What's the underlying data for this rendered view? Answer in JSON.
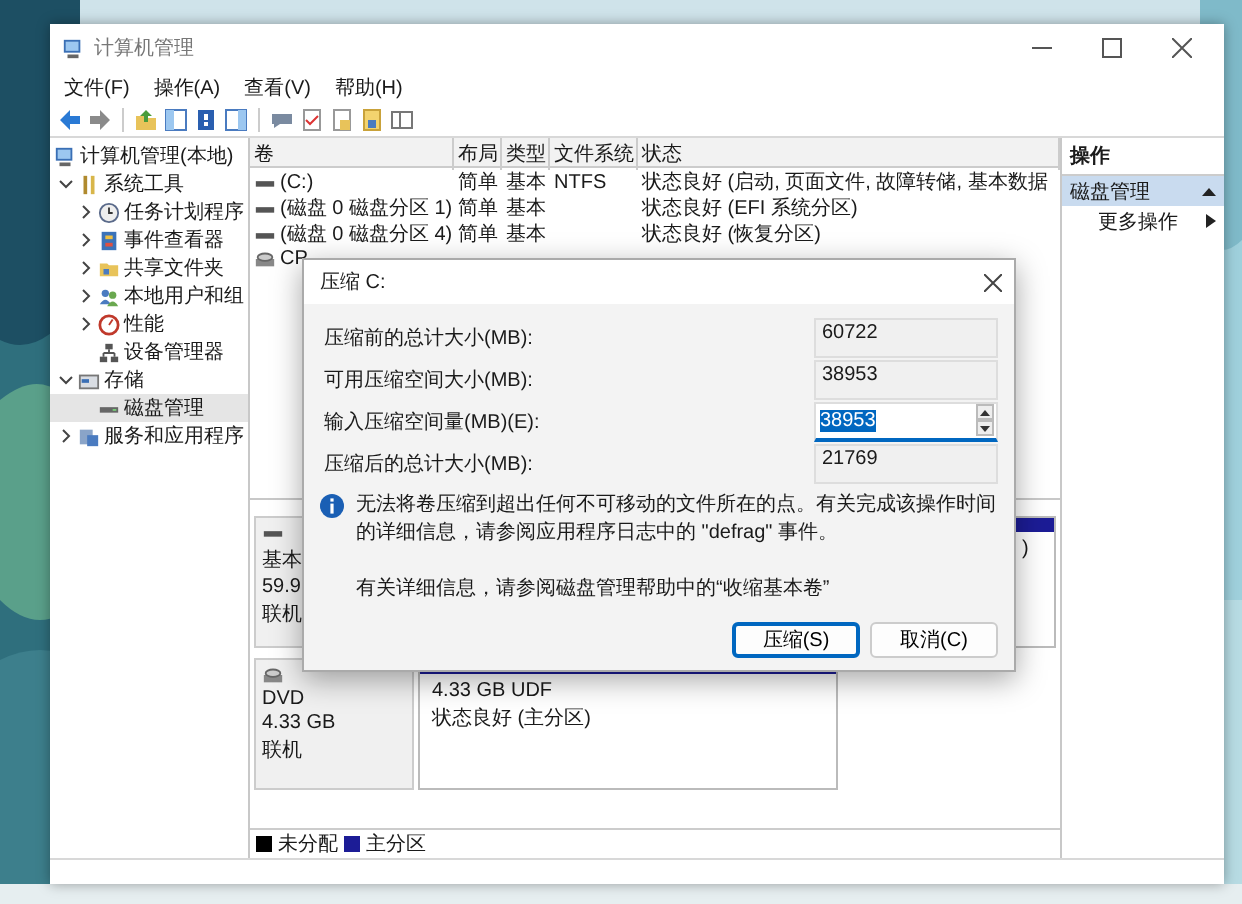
{
  "window": {
    "title": "计算机管理"
  },
  "menu": [
    "文件(F)",
    "操作(A)",
    "查看(V)",
    "帮助(H)"
  ],
  "tree": {
    "root": "计算机管理(本地)",
    "items": [
      {
        "label": "系统工具",
        "expanded": true,
        "selected": false,
        "children": [
          {
            "label": "任务计划程序",
            "expanded": false,
            "selected": false
          },
          {
            "label": "事件查看器",
            "expanded": false,
            "selected": false
          },
          {
            "label": "共享文件夹",
            "expanded": false,
            "selected": false
          },
          {
            "label": "本地用户和组",
            "expanded": false,
            "selected": false
          },
          {
            "label": "性能",
            "expanded": false,
            "selected": false
          },
          {
            "label": "设备管理器",
            "selected": false
          }
        ]
      },
      {
        "label": "存储",
        "expanded": true,
        "selected": false,
        "children": [
          {
            "label": "磁盘管理",
            "selected": true
          }
        ]
      },
      {
        "label": "服务和应用程序",
        "expanded": false,
        "selected": false
      }
    ]
  },
  "volumes": {
    "columns": [
      "卷",
      "布局",
      "类型",
      "文件系统",
      "状态"
    ],
    "rows": [
      {
        "kind": "partition",
        "cells": [
          "(C:)",
          "简单",
          "基本",
          "NTFS",
          "状态良好 (启动, 页面文件, 故障转储, 基本数据"
        ]
      },
      {
        "kind": "partition",
        "cells": [
          "(磁盘 0 磁盘分区 1)",
          "简单",
          "基本",
          "",
          "状态良好 (EFI 系统分区)"
        ]
      },
      {
        "kind": "partition",
        "cells": [
          "(磁盘 0 磁盘分区 4)",
          "简单",
          "基本",
          "",
          "状态良好 (恢复分区)"
        ]
      },
      {
        "kind": "cdrom",
        "cells": [
          "CP"
        ]
      }
    ]
  },
  "disks": [
    {
      "kind": "disk",
      "info": [
        "基本",
        "59.9",
        "联机"
      ],
      "partitions": [
        {
          "kind": "primary",
          "lines": [
            ")"
          ]
        }
      ]
    },
    {
      "kind": "dvd",
      "info": [
        "DVD",
        "4.33 GB",
        "联机"
      ],
      "partitions": [
        {
          "kind": "primary",
          "lines": [
            "4.33 GB UDF",
            "状态良好 (主分区)"
          ]
        }
      ]
    }
  ],
  "legend": [
    {
      "label": "未分配",
      "color": "#000000"
    },
    {
      "label": "主分区",
      "color": "#1c1c96"
    }
  ],
  "actions": {
    "title": "操作",
    "items": [
      {
        "kind": "section",
        "label": "磁盘管理",
        "selected": true
      },
      {
        "kind": "item",
        "label": "更多操作",
        "selected": false
      }
    ]
  },
  "dialog": {
    "title": "压缩 C:",
    "fields": [
      {
        "kind": "readonly",
        "label": "压缩前的总计大小(MB):",
        "value": "60722"
      },
      {
        "kind": "readonly",
        "label": "可用压缩空间大小(MB):",
        "value": "38953"
      },
      {
        "kind": "spin",
        "label": "输入压缩空间量(MB)(E):",
        "value": "38953",
        "text_selected": true
      },
      {
        "kind": "readonly",
        "label": "压缩后的总计大小(MB):",
        "value": "21769"
      }
    ],
    "info": "无法将卷压缩到超出任何不可移动的文件所在的点。有关完成该操作时间的详细信息，请参阅应用程序日志中的 \"defrag\" 事件。",
    "help": "有关详细信息，请参阅磁盘管理帮助中的“收缩基本卷”",
    "buttons": [
      {
        "label": "压缩(S)",
        "default": true
      },
      {
        "label": "取消(C)",
        "default": false
      }
    ]
  }
}
